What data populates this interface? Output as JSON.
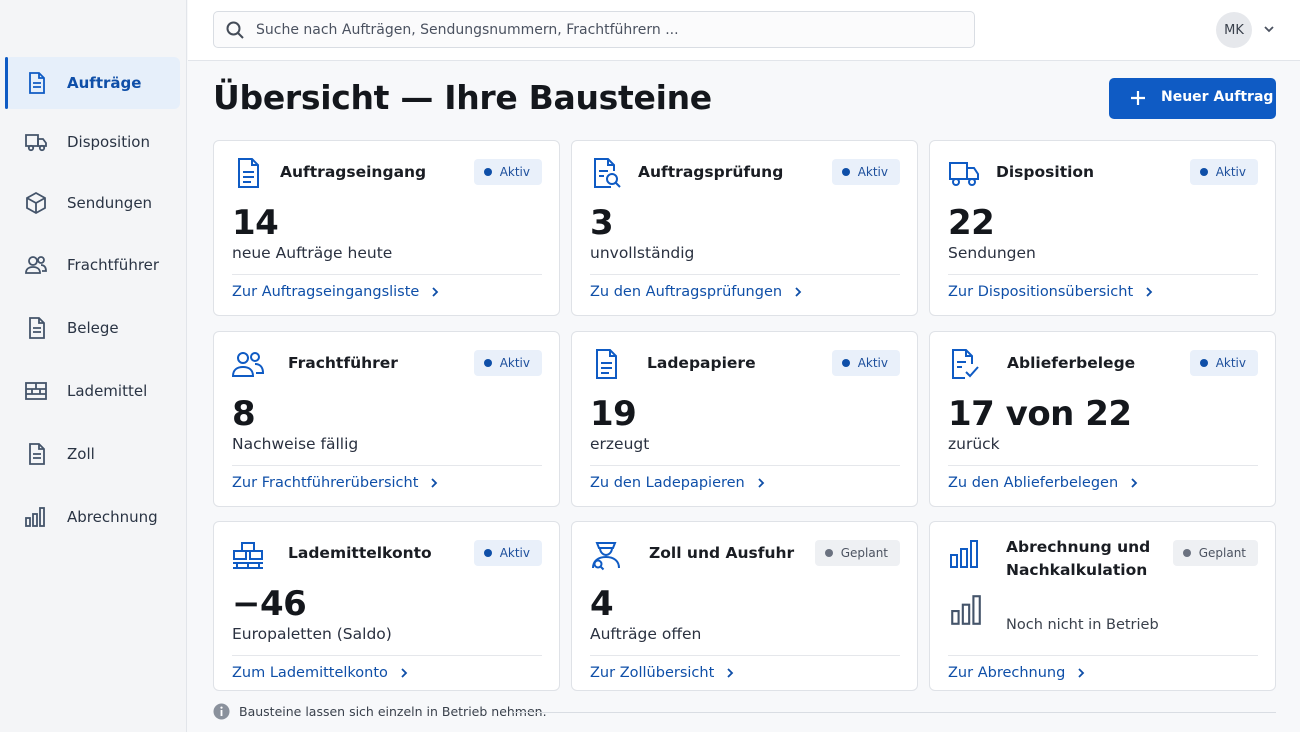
{
  "sidebar": {
    "items": [
      {
        "label": "Aufträge",
        "icon": "document-icon"
      },
      {
        "label": "Disposition",
        "icon": "truck-icon"
      },
      {
        "label": "Sendungen",
        "icon": "package-icon"
      },
      {
        "label": "Frachtführer",
        "icon": "users-icon"
      },
      {
        "label": "Belege",
        "icon": "document-icon"
      },
      {
        "label": "Lademittel",
        "icon": "pallet-icon"
      },
      {
        "label": "Zoll",
        "icon": "document-icon"
      },
      {
        "label": "Abrechnung",
        "icon": "bar-chart-icon"
      }
    ]
  },
  "topbar": {
    "search_placeholder": "Suche nach Aufträgen, Sendungsnummern, Frachtführern ...",
    "avatar_initials": "MK"
  },
  "main": {
    "title": "Übersicht — Ihre Bausteine",
    "new_button": "Neuer Auftrag",
    "cards": [
      {
        "title": "Auftragseingang",
        "badge": "Aktiv",
        "value": "14",
        "sub": "neue Aufträge heute",
        "link": "Zur Auftragseingangsliste"
      },
      {
        "title": "Auftragsprüfung",
        "badge": "Aktiv",
        "value": "3",
        "sub": "unvollständig",
        "link": "Zu den Auftragsprüfungen"
      },
      {
        "title": "Disposition",
        "badge": "Aktiv",
        "value": "22",
        "sub": "Sendungen",
        "link": "Zur Dispositionsübersicht"
      },
      {
        "title": "Frachtführer",
        "badge": "Aktiv",
        "value": "8",
        "sub": "Nachweise fällig",
        "link": "Zur Frachtführerübersicht"
      },
      {
        "title": "Ladepapiere",
        "badge": "Aktiv",
        "value": "19",
        "sub": "erzeugt",
        "link": "Zu den Ladepapieren"
      },
      {
        "title": "Ablieferbelege",
        "badge": "Aktiv",
        "value": "17 von 22",
        "sub": "zurück",
        "link": "Zu den Ablieferbelegen"
      },
      {
        "title": "Lademittelkonto",
        "badge": "Aktiv",
        "value": "−46",
        "sub": "Europaletten (Saldo)",
        "link": "Zum Lademittelkonto"
      },
      {
        "title": "Zoll und Ausfuhr",
        "badge": "Geplant",
        "value": "4",
        "sub": "Aufträge offen",
        "link": "Zur Zollübersicht"
      },
      {
        "title": "Abrechnung und Nachkalkulation",
        "badge": "Geplant",
        "placeholder": "Noch nicht in Betrieb",
        "link": "Zur Abrechnung"
      }
    ],
    "footer_note": "Bausteine lassen sich einzeln in Betrieb nehmen."
  },
  "colors": {
    "accent": "#0f5bc4",
    "active_badge_bg": "#e9f0fa",
    "planned_badge_bg": "#eef0f3"
  }
}
